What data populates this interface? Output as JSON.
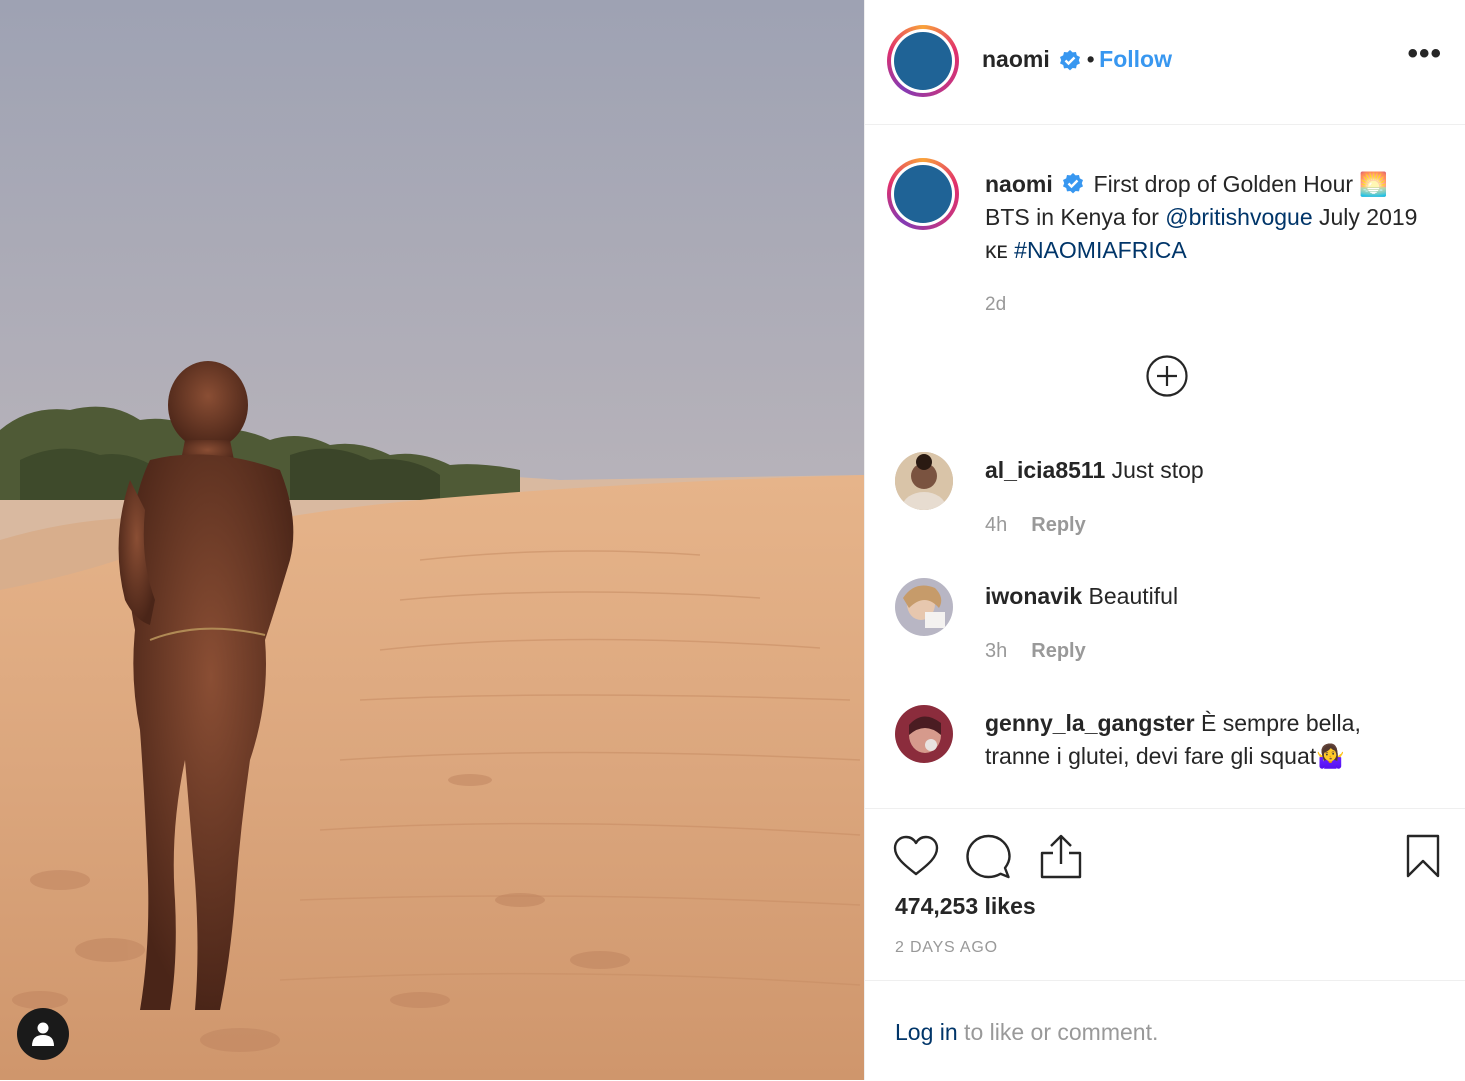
{
  "post": {
    "username": "naomi",
    "separator": "•",
    "follow_label": "Follow",
    "more_label": "•••"
  },
  "caption": {
    "username": "naomi",
    "text_before": "First drop of Golden Hour 🌅 BTS in Kenya for ",
    "mention": "@britishvogue",
    "text_middle": " July 2019 ᴋᴇ ",
    "hashtag": "#NAOMIAFRICA",
    "time": "2d"
  },
  "comments": [
    {
      "username": "al_icia8511",
      "text": "Just stop",
      "time": "4h",
      "reply": "Reply"
    },
    {
      "username": "iwonavik",
      "text": "Beautiful",
      "time": "3h",
      "reply": "Reply"
    },
    {
      "username": "genny_la_gangster",
      "text": "È sempre bella, tranne i glutei, devi fare gli squat🤷‍♀️"
    }
  ],
  "stats": {
    "likes": "474,253 likes",
    "posted": "2 DAYS AGO"
  },
  "login": {
    "link": "Log in",
    "rest": " to like or comment."
  },
  "colors": {
    "accent": "#3897f0",
    "link": "#003569",
    "avatar": "#1f6396",
    "muted": "#999999"
  }
}
